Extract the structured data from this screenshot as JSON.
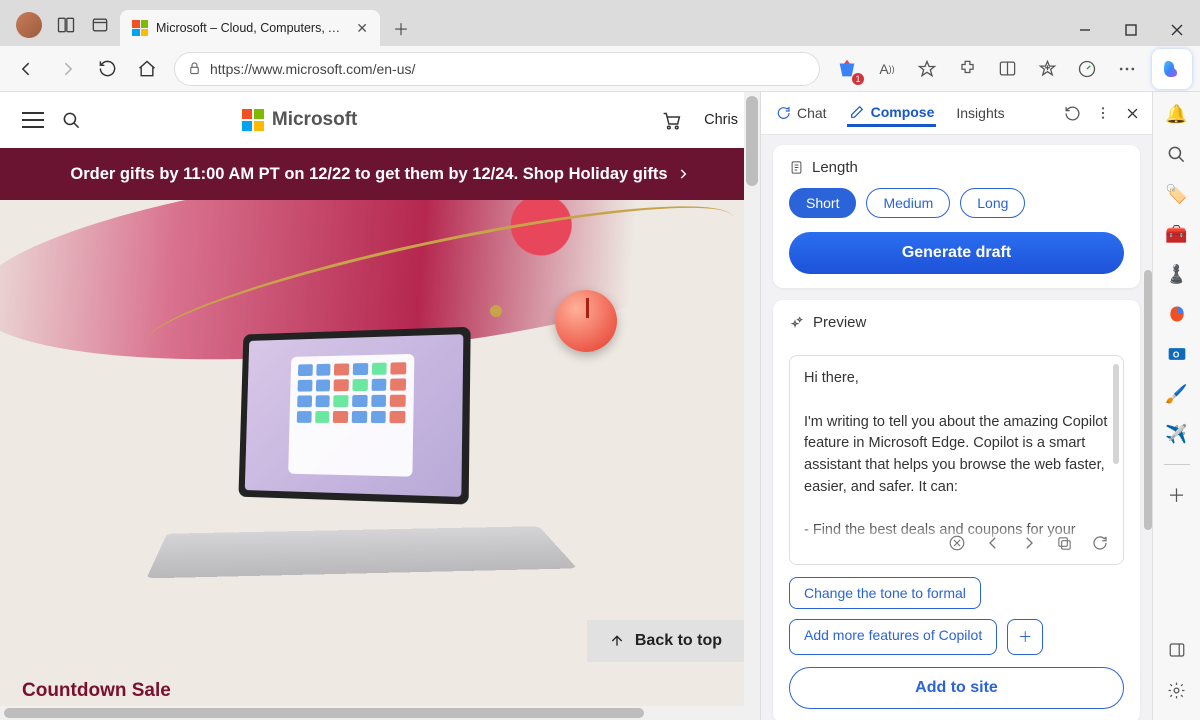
{
  "browser": {
    "tab_title": "Microsoft – Cloud, Computers, A…",
    "url": "https://www.microsoft.com/en-us/",
    "shopping_badge": "1"
  },
  "page": {
    "logo_text": "Microsoft",
    "user_name": "Chris",
    "promo_text": "Order gifts by 11:00 AM PT on 12/22 to get them by 12/24. Shop Holiday gifts",
    "back_to_top": "Back to top",
    "countdown_heading": "Countdown Sale"
  },
  "copilot": {
    "tabs": {
      "chat": "Chat",
      "compose": "Compose",
      "insights": "Insights"
    },
    "length_label": "Length",
    "length_options": {
      "short": "Short",
      "medium": "Medium",
      "long": "Long"
    },
    "generate_label": "Generate draft",
    "preview_label": "Preview",
    "preview_text_l1": "Hi there,",
    "preview_text_l2": "I'm writing to tell you about the amazing Copilot feature in Microsoft Edge. Copilot is a smart assistant that helps you browse the web faster, easier, and safer. It can:",
    "preview_text_l3": "- Find the best deals and coupons for your online shopping",
    "suggestions": {
      "tone": "Change the tone to formal",
      "more": "Add more features of Copilot"
    },
    "add_to_site": "Add to site"
  }
}
